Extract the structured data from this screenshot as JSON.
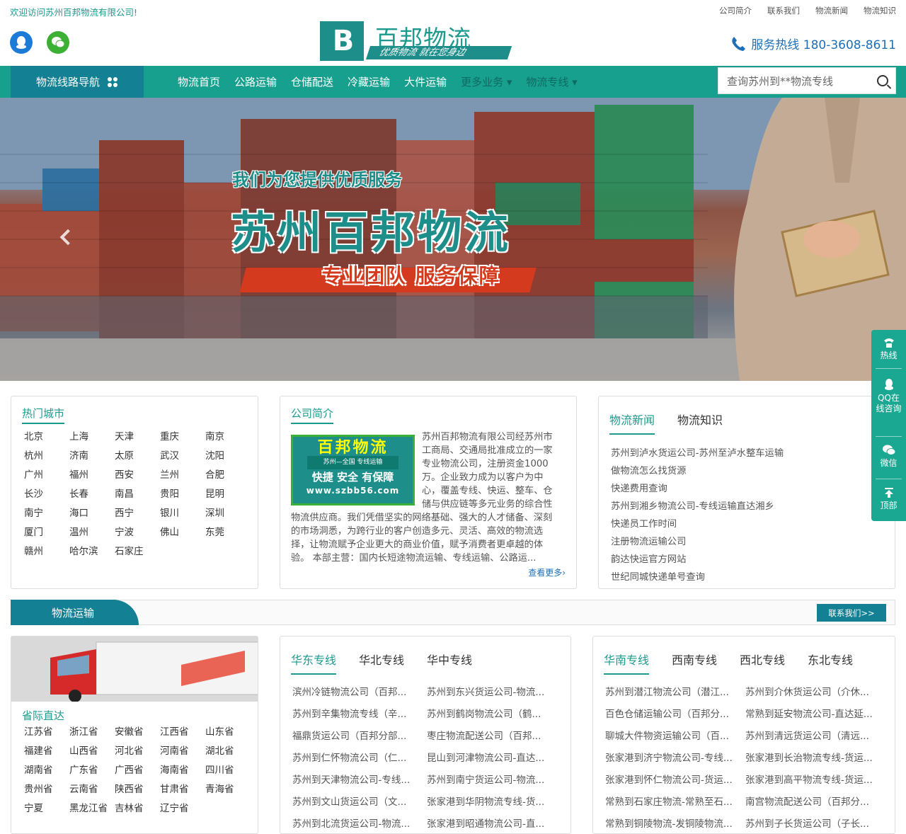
{
  "topbar": {
    "welcome": "欢迎访问苏州百邦物流有限公司!",
    "links": [
      "公司简介",
      "联系我们",
      "物流新闻",
      "物流知识"
    ]
  },
  "header": {
    "logo_mark": "B",
    "logo_name": "百邦物流",
    "logo_slogan": "优质物流 就在您身边",
    "hotline": "服务热线 180-3608-8611"
  },
  "nav": {
    "guide": "物流线路导航",
    "items": [
      "物流首页",
      "公路运输",
      "仓储配送",
      "冷藏运输",
      "大件运输",
      "更多业务 ▾",
      "物流专线 ▾"
    ],
    "search_placeholder": "查询苏州到**物流专线"
  },
  "banner": {
    "line1": "我们为您提供优质服务",
    "line2": "苏州百邦物流",
    "line3": "专业团队  服务保障"
  },
  "hot_cities": {
    "title": "热门城市",
    "items": [
      "北京",
      "上海",
      "天津",
      "重庆",
      "南京",
      "杭州",
      "济南",
      "太原",
      "武汉",
      "沈阳",
      "广州",
      "福州",
      "西安",
      "兰州",
      "合肥",
      "长沙",
      "长春",
      "南昌",
      "贵阳",
      "昆明",
      "南宁",
      "海口",
      "西宁",
      "银川",
      "深圳",
      "厦门",
      "温州",
      "宁波",
      "佛山",
      "东莞",
      "赣州",
      "哈尔滨",
      "石家庄"
    ]
  },
  "intro": {
    "title": "公司简介",
    "img_line1": "百邦物流",
    "img_line2": "苏州—全国 专线运输",
    "img_line3": "快捷 安全 有保障",
    "img_line4": "www.szbb56.com",
    "text": "苏州百邦物流有限公司经苏州市工商局、交通局批准成立的一家专业物流公司，注册资金1000万。企业致力成为以客户为中心，覆盖专线、快运、整车、仓储与供应链等多元业务的综合性物流供应商。我们凭借坚实的网络基础、强大的人才储备、深刻的市场洞悉，为跨行业的客户创造多元、灵活、高效的物流选择，让物流赋予企业更大的商业价值，赋予消费者更卓越的体验。 本部主营：国内长短途物流运输、专线运输、公路运...",
    "more": "查看更多›"
  },
  "news": {
    "tabs": [
      "物流新闻",
      "物流知识"
    ],
    "items": [
      "苏州到泸水货运公司-苏州至泸水整车运输",
      "做物流怎么找货源",
      "快递费用查询",
      "苏州到湘乡物流公司-专线运输直达湘乡",
      "快递员工作时间",
      "注册物流运输公司",
      "韵达快运官方网站",
      "世纪同城快递单号查询"
    ]
  },
  "section": {
    "tab": "物流运输",
    "contact": "联系我们>>"
  },
  "provinces": {
    "title": "省际直达",
    "items": [
      "江苏省",
      "浙江省",
      "安徽省",
      "江西省",
      "山东省",
      "福建省",
      "山西省",
      "河北省",
      "河南省",
      "湖北省",
      "湖南省",
      "广东省",
      "广西省",
      "海南省",
      "四川省",
      "贵州省",
      "云南省",
      "陕西省",
      "甘肃省",
      "青海省",
      "宁夏",
      "黑龙江省",
      "吉林省",
      "辽宁省"
    ]
  },
  "lines_a": {
    "tabs": [
      "华东专线",
      "华北专线",
      "华中专线"
    ],
    "items": [
      "滨州冷链物流公司（百邦...",
      "苏州到东兴货运公司-物流...",
      "苏州到辛集物流专线（辛...",
      "苏州到鹤岗物流公司（鹤...",
      "福鼎货运公司（百邦分部...",
      "枣庄物流配送公司（百邦...",
      "苏州到仁怀物流公司（仁...",
      "昆山到河津物流公司-直达...",
      "苏州到天津物流公司-专线...",
      "苏州到南宁货运公司-物流...",
      "苏州到文山货运公司（文...",
      "张家港到华阴物流专线-货...",
      "苏州到北流货运公司-物流...",
      "张家港到昭通物流公司-直..."
    ]
  },
  "lines_b": {
    "tabs": [
      "华南专线",
      "西南专线",
      "西北专线",
      "东北专线"
    ],
    "items": [
      "苏州到潜江物流公司（潜江...",
      "苏州到介休货运公司（介休...",
      "百色仓储运输公司（百邦分...",
      "常熟到延安物流公司-直达延...",
      "聊城大件物资运输公司（百...",
      "苏州到清远货运公司（清远...",
      "张家港到济宁物流公司-专线...",
      "张家港到长治物流专线-货运...",
      "张家港到怀仁物流公司-货运...",
      "张家港到高平物流专线-货运...",
      "常熟到石家庄物流-常熟至石...",
      "南宫物流配送公司（百邦分...",
      "常熟到铜陵物流-发铜陵物流...",
      "苏州到子长货运公司（子长..."
    ]
  },
  "sidebar": {
    "items": [
      "热线",
      "QQ在线咨询",
      "微信",
      "顶部"
    ]
  },
  "colors": {
    "brand": "#1c9a8e",
    "nav": "#18a08f",
    "dark": "#138193",
    "accent_red": "#d33a1e"
  }
}
